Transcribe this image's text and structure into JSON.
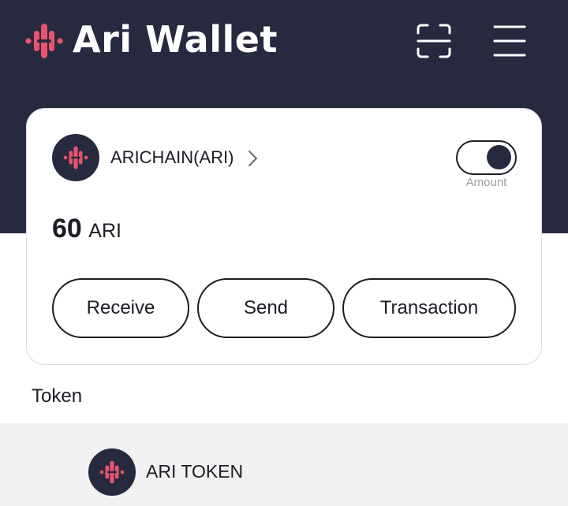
{
  "header": {
    "title": "Ari Wallet",
    "logo_icon": "ari-logo-icon",
    "scan_icon": "scan-icon",
    "menu_icon": "hamburger-menu-icon"
  },
  "wallet_card": {
    "chain_name": "ARICHAIN(ARI)",
    "amount_toggle_label": "Amount",
    "amount_toggle_on": true,
    "balance_value": "60",
    "balance_unit": "ARI",
    "buttons": {
      "receive": "Receive",
      "send": "Send",
      "transaction": "Transaction"
    }
  },
  "tokens": {
    "section_label": "Token",
    "items": [
      {
        "name": "ARI TOKEN"
      }
    ]
  },
  "colors": {
    "header_bg": "#272a3f",
    "brand_pink": "#e8546e",
    "text": "#1c1c24",
    "muted": "#9a9ca3",
    "row_bg": "#f1f1f2"
  }
}
